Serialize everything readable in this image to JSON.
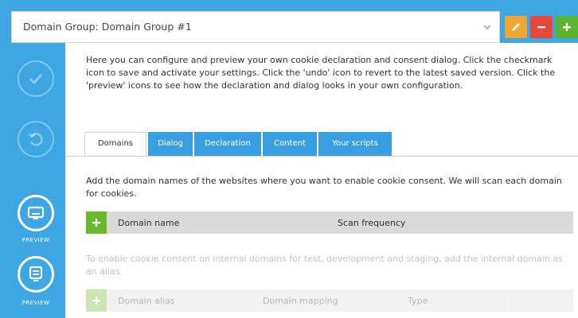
{
  "domain_group": {
    "selected": "Domain Group: Domain Group #1",
    "buttons": {
      "edit": "pencil-icon",
      "delete": "minus-icon",
      "add": "plus-icon"
    }
  },
  "rail": {
    "save_icon": "checkmark-icon",
    "revert_icon": "undo-icon",
    "preview_banner_label": "PREVIEW",
    "preview_dialog_label": "PREVIEW"
  },
  "intro_text": "Here you can configure and preview your own cookie declaration and consent dialog. Click the checkmark icon to save and activate your settings. Click the 'undo' icon to revert to the latest saved version. Click the 'preview' icons to see how the declaration and dialog looks in your own configuration.",
  "tabs": [
    {
      "label": "Domains",
      "active": true
    },
    {
      "label": "Dialog",
      "active": false
    },
    {
      "label": "Declaration",
      "active": false
    },
    {
      "label": "Content",
      "active": false
    },
    {
      "label": "Your scripts",
      "active": false
    }
  ],
  "domains": {
    "description": "Add the domain names of the websites where you want to enable cookie consent. We will scan each domain for cookies.",
    "columns": [
      "Domain name",
      "Scan frequency"
    ]
  },
  "aliases": {
    "note": "To enable cookie consent on internal domains for test, development and staging, add the internal domain as an alias.",
    "columns": [
      "Domain alias",
      "Domain mapping",
      "Type"
    ]
  },
  "colors": {
    "background": "#3ea6e3",
    "tab_inactive": "#3a9fe0",
    "add_green": "#5ab52d",
    "edit_orange": "#f3a531",
    "delete_red": "#e8483b"
  }
}
